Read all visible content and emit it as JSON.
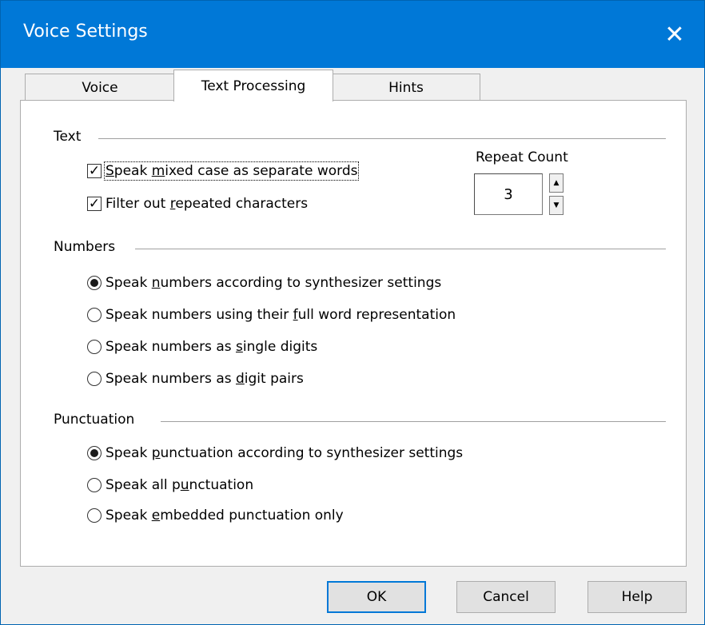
{
  "window": {
    "title": "Voice Settings"
  },
  "tabs": [
    {
      "label": "Voice"
    },
    {
      "label": "Text Processing"
    },
    {
      "label": "Hints"
    }
  ],
  "text_group": {
    "label": "Text",
    "mixed_case": {
      "pre": "",
      "accel": "S",
      "post": "peak ",
      "accel2": "m",
      "post2": "ixed case as separate words",
      "checked": true
    },
    "filter_repeated": {
      "pre": "Filter out ",
      "accel": "r",
      "post": "epeated characters",
      "checked": true
    },
    "repeat_count": {
      "label": "Repeat Count",
      "value": "3"
    }
  },
  "numbers_group": {
    "label": "Numbers",
    "options": [
      {
        "pre": "Speak ",
        "accel": "n",
        "post": "umbers according to synthesizer settings",
        "selected": true
      },
      {
        "pre": "Speak numbers using their ",
        "accel": "f",
        "post": "ull word representation",
        "selected": false
      },
      {
        "pre": "Speak numbers as ",
        "accel": "s",
        "post": "ingle digits",
        "selected": false
      },
      {
        "pre": "Speak numbers as ",
        "accel": "d",
        "post": "igit pairs",
        "selected": false
      }
    ]
  },
  "punctuation_group": {
    "label": "Punctuation",
    "options": [
      {
        "pre": "Speak ",
        "accel": "p",
        "post": "unctuation according to synthesizer settings",
        "selected": true
      },
      {
        "pre": "Speak all p",
        "accel": "u",
        "post": "nctuation",
        "selected": false
      },
      {
        "pre": "Speak ",
        "accel": "e",
        "post": "mbedded punctuation only",
        "selected": false
      }
    ]
  },
  "buttons": {
    "ok": "OK",
    "cancel": "Cancel",
    "help": "Help"
  },
  "icons": {
    "close": "close-icon",
    "spin_up": "spin-up-icon",
    "spin_down": "spin-down-icon"
  }
}
